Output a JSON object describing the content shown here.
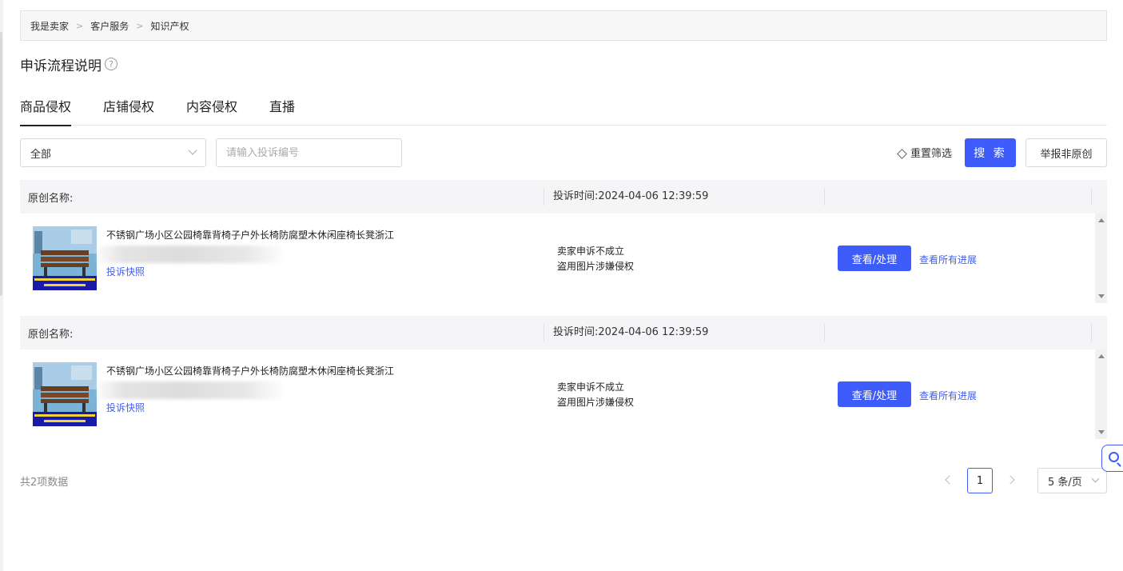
{
  "breadcrumb": {
    "items": [
      "我是卖家",
      "客户服务",
      "知识产权"
    ],
    "separator": ">"
  },
  "page": {
    "title": "申诉流程说明",
    "help_icon": "?"
  },
  "tabs": [
    {
      "label": "商品侵权",
      "active": true
    },
    {
      "label": "店铺侵权",
      "active": false
    },
    {
      "label": "内容侵权",
      "active": false
    },
    {
      "label": "直播",
      "active": false
    }
  ],
  "filters": {
    "select_value": "全部",
    "search_placeholder": "请输入投诉编号",
    "reset_label": "重置筛选",
    "search_button": "搜 索",
    "report_button": "举报非原创"
  },
  "records": [
    {
      "original_name_label": "原创名称:",
      "complaint_time": "投诉时间:2024-04-06 12:39:59",
      "product_title": "不锈钢广场小区公园椅靠背椅子户外长椅防腐塑木休闲座椅长凳浙江",
      "snapshot_link": "投诉快照",
      "status_line1": "卖家申诉不成立",
      "status_line2": "盗用图片涉嫌侵权",
      "view_button": "查看/处理",
      "progress_link": "查看所有进展"
    },
    {
      "original_name_label": "原创名称:",
      "complaint_time": "投诉时间:2024-04-06 12:39:59",
      "product_title": "不锈钢广场小区公园椅靠背椅子户外长椅防腐塑木休闲座椅长凳浙江",
      "snapshot_link": "投诉快照",
      "status_line1": "卖家申诉不成立",
      "status_line2": "盗用图片涉嫌侵权",
      "view_button": "查看/处理",
      "progress_link": "查看所有进展"
    }
  ],
  "pagination": {
    "total": "共2项数据",
    "current_page": "1",
    "page_size": "5 条/页"
  },
  "colors": {
    "primary": "#3d5cfa",
    "header_bg": "#f5f5f7"
  },
  "icons": {
    "help": "question-circle-icon",
    "reset": "eraser-icon",
    "float": "search-icon"
  }
}
